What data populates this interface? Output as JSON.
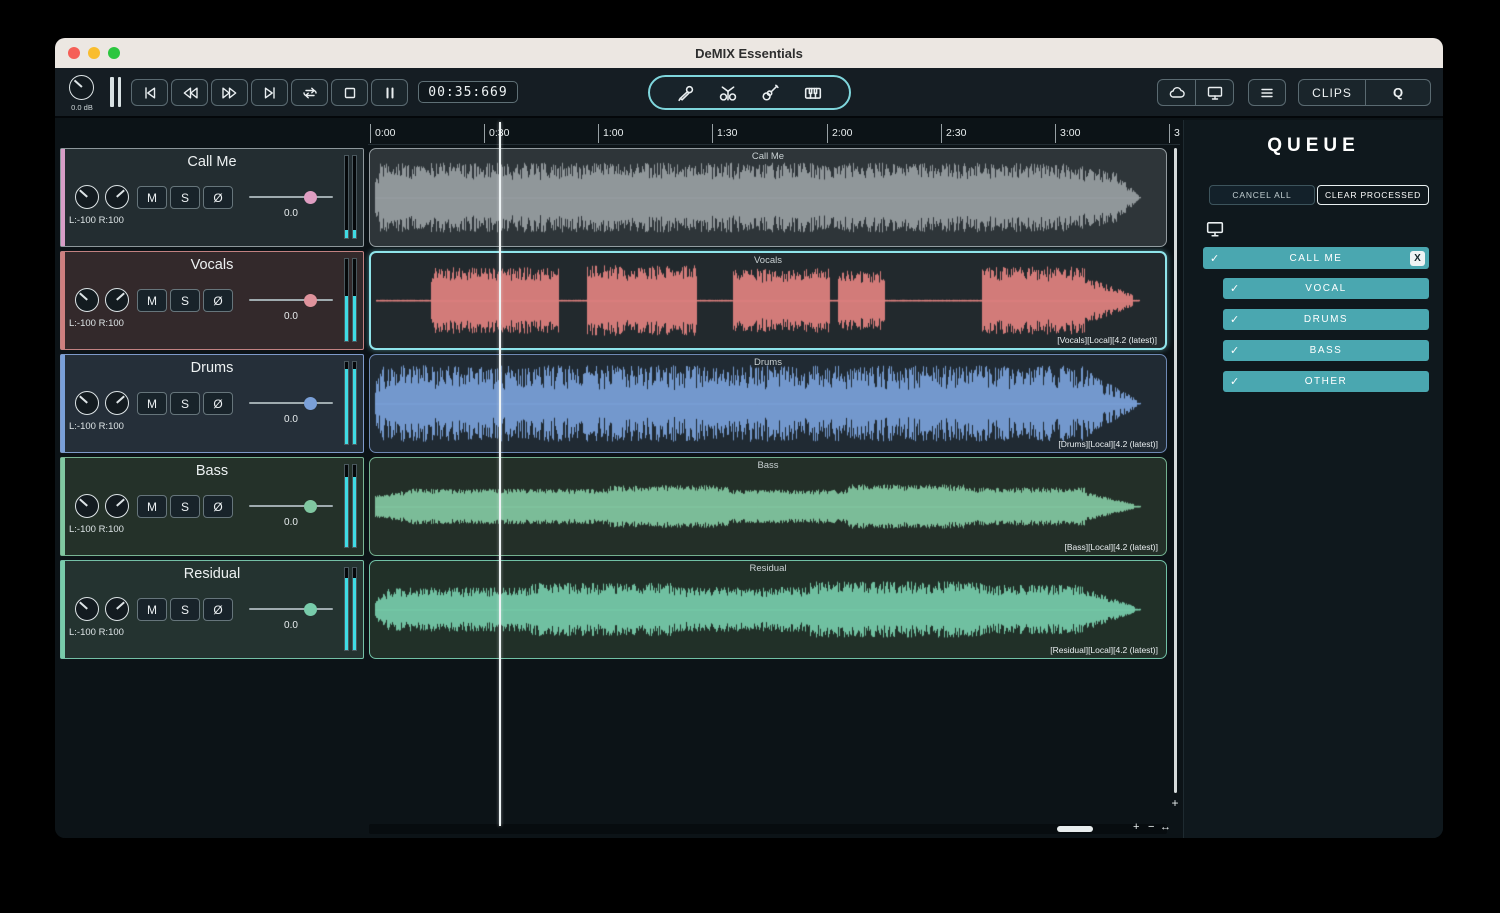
{
  "window": {
    "title": "DeMIX Essentials"
  },
  "toolbar": {
    "gain_label": "0.0 dB",
    "time_display": "00:35:669",
    "clips_label": "CLIPS",
    "queue_btn_label": "Q"
  },
  "controls": {
    "mute": "M",
    "solo": "S",
    "phase": "Ø"
  },
  "timeline": {
    "ticks": [
      "0:00",
      "0:30",
      "1:00",
      "1:30",
      "2:00",
      "2:30",
      "3:00",
      "3"
    ]
  },
  "tracks": [
    {
      "name": "Call Me",
      "volume": "0.0",
      "pan": "L:-100 R:100",
      "header_bg": "#232d31",
      "border": "#8d979b",
      "stripe": "#d79ec7",
      "handle": "#df9ec2",
      "meter_level": 10
    },
    {
      "name": "Vocals",
      "volume": "0.0",
      "pan": "L:-100 R:100",
      "header_bg": "#33292b",
      "border": "#c28181",
      "stripe": "#cd7f7f",
      "handle": "#df939c",
      "meter_level": 55
    },
    {
      "name": "Drums",
      "volume": "0.0",
      "pan": "L:-100 R:100",
      "header_bg": "#252f39",
      "border": "#7e9aca",
      "stripe": "#7aa0d8",
      "handle": "#7aa0d8",
      "meter_level": 92
    },
    {
      "name": "Bass",
      "volume": "0.0",
      "pan": "L:-100 R:100",
      "header_bg": "#243129",
      "border": "#78b493",
      "stripe": "#80c7a1",
      "handle": "#80c7a1",
      "meter_level": 85
    },
    {
      "name": "Residual",
      "volume": "0.0",
      "pan": "L:-100 R:100",
      "header_bg": "#243330",
      "border": "#74c0a6",
      "stripe": "#78cbaa",
      "handle": "#78cbaa",
      "meter_level": 88
    }
  ],
  "regions": [
    {
      "title": "Call Me",
      "tag": "",
      "bg": "#2e3539",
      "border": "#939b9f",
      "wave_color": "#999fa3",
      "selected": false,
      "seed": 11,
      "jitter": 0.5,
      "env": [
        [
          0,
          0.01,
          0.2,
          0.7
        ],
        [
          0.01,
          0.88,
          0.82,
          0.82
        ],
        [
          0.88,
          0.94,
          0.8,
          0.6
        ],
        [
          0.94,
          0.968,
          0.55,
          0.08
        ]
      ]
    },
    {
      "title": "Vocals",
      "tag": "[Vocals][Local][4.2 (latest)]",
      "bg": "#22292d",
      "border": "#8fe4ea",
      "wave_color": "#e28280",
      "selected": true,
      "seed": 22,
      "jitter": 0.55,
      "env": [
        [
          0.073,
          0.235,
          0.8,
          0.8
        ],
        [
          0.27,
          0.41,
          0.85,
          0.85
        ],
        [
          0.455,
          0.578,
          0.78,
          0.78
        ],
        [
          0.588,
          0.648,
          0.72,
          0.72
        ],
        [
          0.77,
          0.9,
          0.82,
          0.82
        ],
        [
          0.9,
          0.962,
          0.6,
          0.15
        ]
      ]
    },
    {
      "title": "Drums",
      "tag": "[Drums][Local][4.2 (latest)]",
      "bg": "#202a33",
      "border": "#6e89b4",
      "wave_color": "#7ba2da",
      "selected": false,
      "seed": 33,
      "jitter": 0.35,
      "env": [
        [
          0,
          0.01,
          0.3,
          0.85
        ],
        [
          0.01,
          0.9,
          0.9,
          0.9
        ],
        [
          0.9,
          0.965,
          0.85,
          0.1
        ]
      ]
    },
    {
      "title": "Bass",
      "tag": "[Bass][Local][4.2 (latest)]",
      "bg": "#232f28",
      "border": "#73b08f",
      "wave_color": "#83c9a2",
      "selected": false,
      "seed": 44,
      "jitter": 0.7,
      "env": [
        [
          0,
          0.05,
          0.25,
          0.4
        ],
        [
          0.05,
          0.3,
          0.42,
          0.42
        ],
        [
          0.3,
          0.45,
          0.5,
          0.5
        ],
        [
          0.45,
          0.6,
          0.4,
          0.4
        ],
        [
          0.6,
          0.75,
          0.52,
          0.52
        ],
        [
          0.75,
          0.9,
          0.45,
          0.45
        ],
        [
          0.9,
          0.962,
          0.35,
          0.06
        ]
      ]
    },
    {
      "title": "Residual",
      "tag": "[Residual][Local][4.2 (latest)]",
      "bg": "#213028",
      "border": "#71c1a6",
      "wave_color": "#77cdab",
      "selected": false,
      "seed": 55,
      "jitter": 0.55,
      "env": [
        [
          0,
          0.02,
          0.2,
          0.45
        ],
        [
          0.02,
          0.2,
          0.52,
          0.52
        ],
        [
          0.2,
          0.38,
          0.63,
          0.63
        ],
        [
          0.38,
          0.55,
          0.53,
          0.53
        ],
        [
          0.55,
          0.78,
          0.66,
          0.66
        ],
        [
          0.78,
          0.9,
          0.58,
          0.58
        ],
        [
          0.9,
          0.963,
          0.5,
          0.08
        ]
      ]
    }
  ],
  "queue": {
    "title": "QUEUE",
    "cancel_all": "CANCEL ALL",
    "clear_processed": "CLEAR PROCESSED",
    "check_glyph": "✓",
    "jobs": [
      {
        "name": "CALL ME",
        "close": "X",
        "stems": [
          "VOCAL",
          "DRUMS",
          "BASS",
          "OTHER"
        ]
      }
    ]
  },
  "scrollbar": {
    "zoom_in": "+",
    "zoom_out": "−",
    "zoom_fit": "↔",
    "vertical_zoom": "+"
  },
  "colors": {
    "accent": "#7fd6dc",
    "queue_row": "#4aa7b0",
    "meter": "#3fdbe4"
  }
}
